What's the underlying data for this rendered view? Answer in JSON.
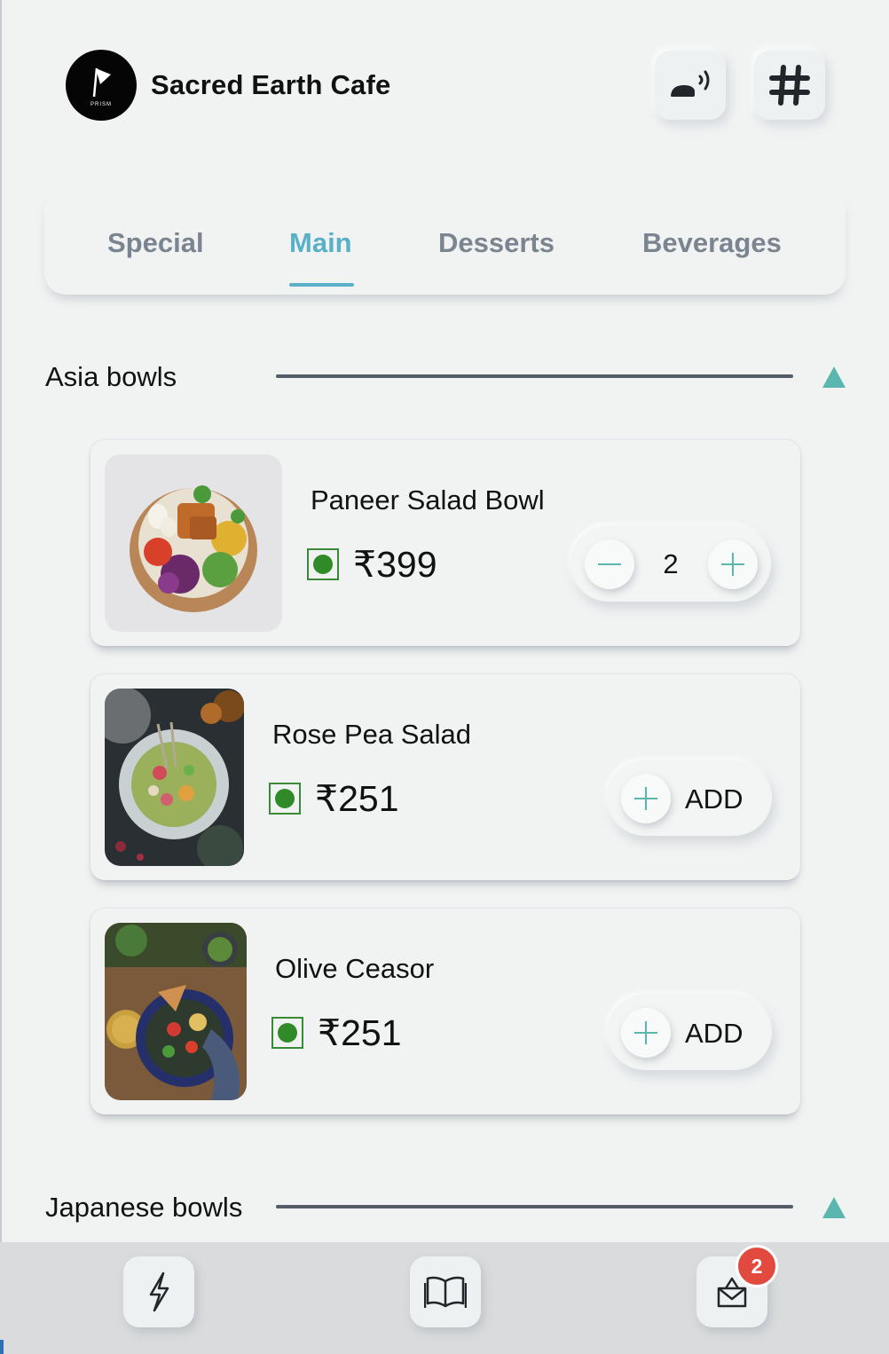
{
  "header": {
    "cafe_name": "Sacred Earth Cafe",
    "logo_text": "PRISM",
    "call_waiter_icon": "call-waiter-icon",
    "table_icon": "hash-icon"
  },
  "tabs": [
    {
      "label": "Special",
      "active": false
    },
    {
      "label": "Main",
      "active": true
    },
    {
      "label": "Desserts",
      "active": false
    },
    {
      "label": "Beverages",
      "active": false
    }
  ],
  "sections": [
    {
      "title": "Asia bowls",
      "expanded": true
    },
    {
      "title": "Japanese bowls",
      "expanded": true
    }
  ],
  "items": [
    {
      "name": "Paneer Salad Bowl",
      "price": "₹399",
      "veg": true,
      "quantity": "2",
      "in_cart": true
    },
    {
      "name": "Rose Pea Salad",
      "price": "₹251",
      "veg": true,
      "add_label": "ADD",
      "in_cart": false
    },
    {
      "name": "Olive Ceasor",
      "price": "₹251",
      "veg": true,
      "add_label": "ADD",
      "in_cart": false
    }
  ],
  "bottom_nav": {
    "items": [
      "flash-icon",
      "menu-book-icon",
      "cart-bag-icon"
    ],
    "cart_badge": "2"
  },
  "colors": {
    "accent": "#5ab1c7",
    "teal": "#5ab7b0",
    "veg_green": "#2f8a27",
    "badge_red": "#e24a3f"
  }
}
